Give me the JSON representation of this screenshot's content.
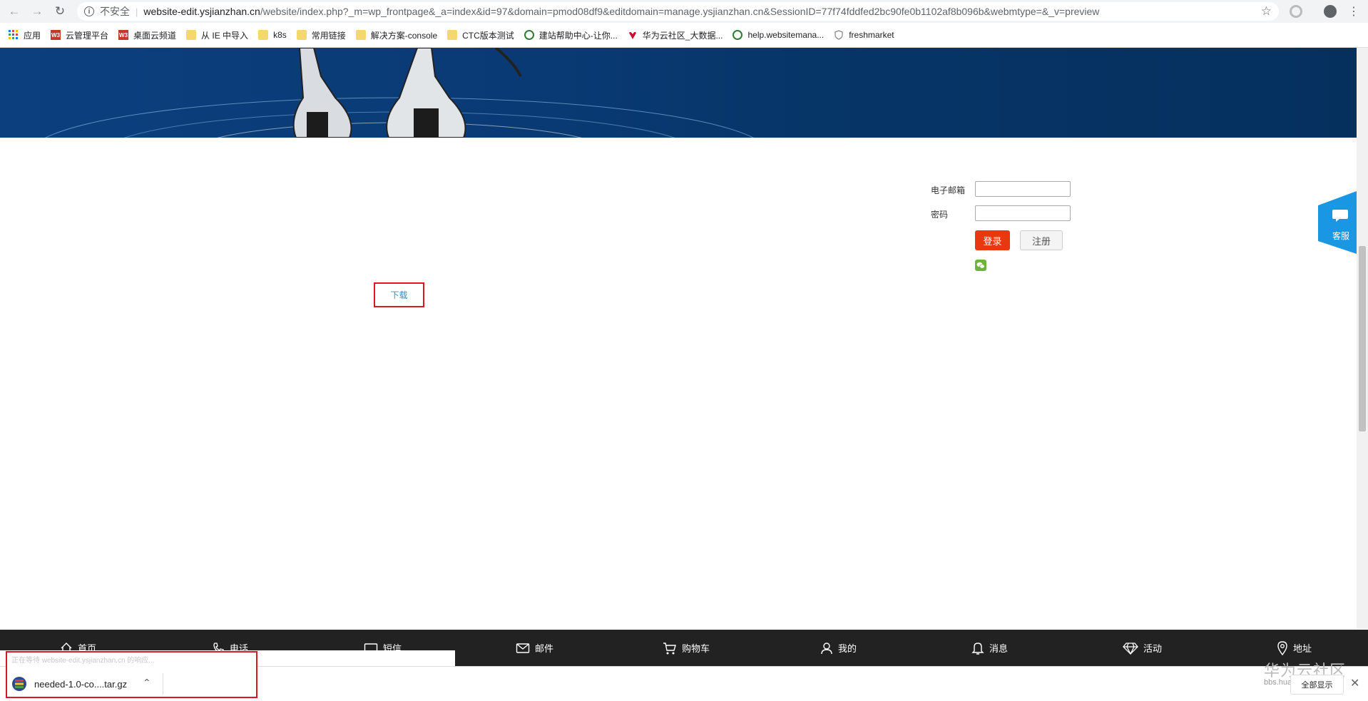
{
  "browser": {
    "insecure_label": "不安全",
    "url_host": "website-edit.ysjianzhan.cn",
    "url_path": "/website/index.php?_m=wp_frontpage&_a=index&id=97&domain=pmod08df9&editdomain=manage.ysjianzhan.cn&SessionID=77f74fddfed2bc90fe0b1102af8b096b&webmtype=&_v=preview",
    "bookmarks": [
      {
        "label": "应用",
        "icon": "apps-icon"
      },
      {
        "label": "云管理平台",
        "icon": "w3-icon"
      },
      {
        "label": "桌面云频道",
        "icon": "w3-icon"
      },
      {
        "label": "从 IE 中导入",
        "icon": "folder-icon"
      },
      {
        "label": "k8s",
        "icon": "folder-icon"
      },
      {
        "label": "常用链接",
        "icon": "folder-icon"
      },
      {
        "label": "解决方案-console",
        "icon": "folder-icon"
      },
      {
        "label": "CTC版本测试",
        "icon": "folder-icon"
      },
      {
        "label": "建站帮助中心-让你...",
        "icon": "green-q-icon"
      },
      {
        "label": "华为云社区_大数据...",
        "icon": "huawei-icon"
      },
      {
        "label": "help.websitemana...",
        "icon": "green-q-icon"
      },
      {
        "label": "freshmarket",
        "icon": "shield-icon"
      }
    ]
  },
  "login": {
    "email_label": "电子邮箱",
    "password_label": "密码",
    "login_button": "登录",
    "register_button": "注册"
  },
  "service_label": "客服",
  "download_link": "下载",
  "bottom_nav": [
    {
      "label": "首页",
      "icon": "home-icon"
    },
    {
      "label": "电话",
      "icon": "phone-icon"
    },
    {
      "label": "短信",
      "icon": "sms-icon"
    },
    {
      "label": "邮件",
      "icon": "mail-icon"
    },
    {
      "label": "购物车",
      "icon": "cart-icon"
    },
    {
      "label": "我的",
      "icon": "user-icon"
    },
    {
      "label": "消息",
      "icon": "bell-icon"
    },
    {
      "label": "活动",
      "icon": "diamond-icon"
    },
    {
      "label": "地址",
      "icon": "location-icon"
    }
  ],
  "downloads": {
    "status_text": "正在等待 website-edit.ysjianzhan.cn 的响应...",
    "file_name": "needed-1.0-co....tar.gz",
    "show_all": "全部显示"
  },
  "watermark": {
    "title": "华为云社区",
    "url": "bbs.huaweicloud.com"
  }
}
